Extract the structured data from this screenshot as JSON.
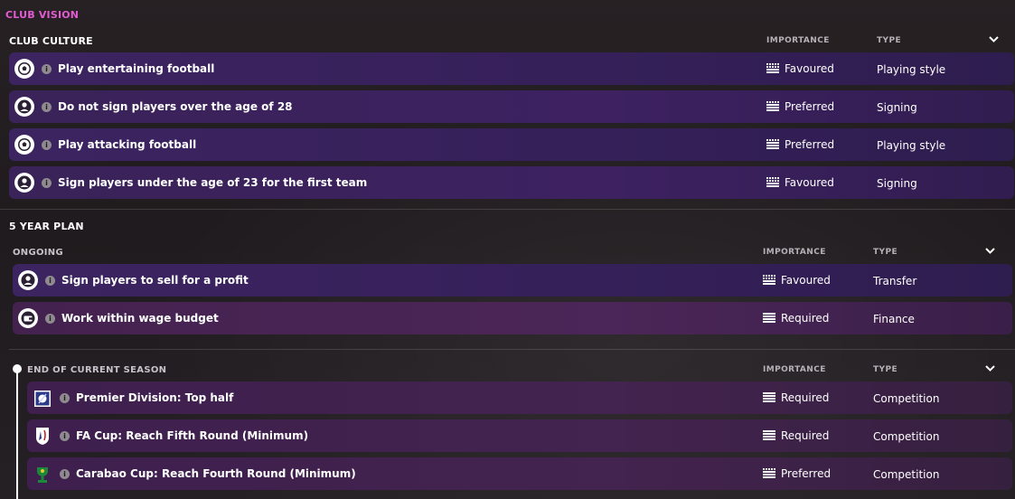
{
  "header": {
    "title": "CLUB VISION"
  },
  "club_culture": {
    "title": "CLUB CULTURE",
    "col_importance": "IMPORTANCE",
    "col_type": "TYPE",
    "items": [
      {
        "icon": "football-icon",
        "label": "Play entertaining football",
        "importance": "Favoured",
        "type": "Playing style"
      },
      {
        "icon": "person-icon",
        "label": "Do not sign players over the age of 28",
        "importance": "Preferred",
        "type": "Signing"
      },
      {
        "icon": "football-icon",
        "label": "Play attacking football",
        "importance": "Preferred",
        "type": "Playing style"
      },
      {
        "icon": "person-icon",
        "label": "Sign players under the age of 23 for the first team",
        "importance": "Favoured",
        "type": "Signing"
      }
    ]
  },
  "five_year_plan": {
    "title": "5 YEAR PLAN",
    "ongoing": {
      "title": "ONGOING",
      "col_importance": "IMPORTANCE",
      "col_type": "TYPE",
      "items": [
        {
          "icon": "person-icon",
          "label": "Sign players to sell for a profit",
          "importance": "Favoured",
          "type": "Transfer"
        },
        {
          "icon": "wallet-icon",
          "label": "Work within wage budget",
          "importance": "Required",
          "type": "Finance"
        }
      ]
    },
    "end_of_season": {
      "title": "END OF CURRENT SEASON",
      "col_importance": "IMPORTANCE",
      "col_type": "TYPE",
      "items": [
        {
          "icon": "premier-division-crest-icon",
          "label": "Premier Division: Top half",
          "importance": "Required",
          "type": "Competition"
        },
        {
          "icon": "fa-cup-crest-icon",
          "label": "FA Cup: Reach Fifth Round (Minimum)",
          "importance": "Required",
          "type": "Competition"
        },
        {
          "icon": "carabao-cup-crest-icon",
          "label": "Carabao Cup: Reach Fourth Round (Minimum)",
          "importance": "Preferred",
          "type": "Competition"
        }
      ]
    }
  },
  "info_glyph": "i",
  "colors": {
    "accent": "#e35bd2",
    "row_purple": "#3c2460",
    "row_plum": "#4b2658"
  }
}
